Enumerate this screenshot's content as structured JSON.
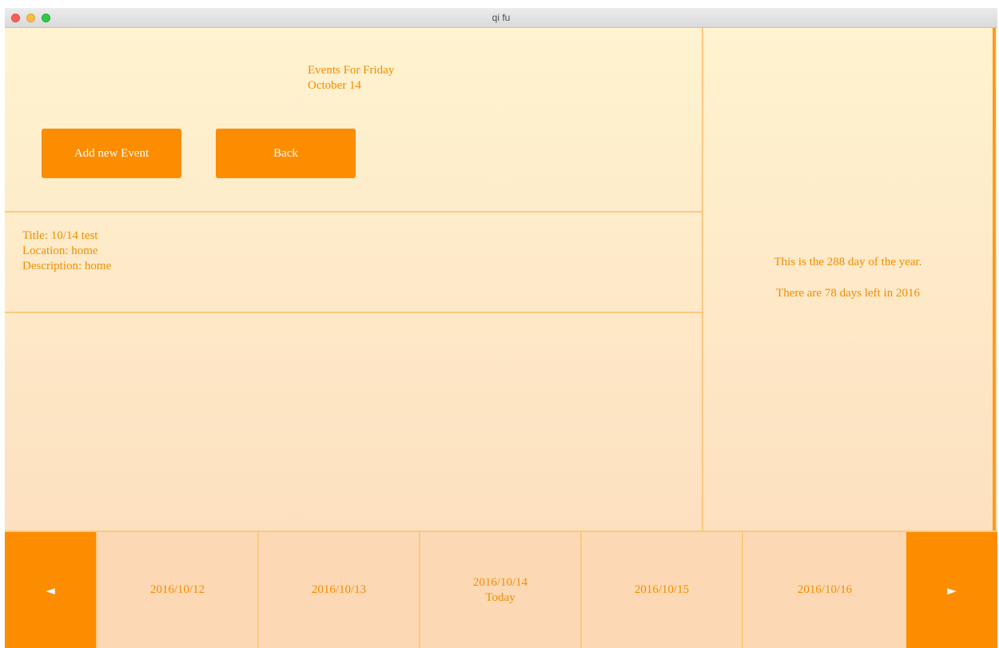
{
  "window": {
    "title": "qi fu"
  },
  "header": {
    "line1": "Events For Friday",
    "line2": "October 14"
  },
  "buttons": {
    "add_label": "Add new Event",
    "back_label": "Back"
  },
  "event": {
    "title": "Title: 10/14 test",
    "location": "Location: home",
    "description": "Description: home"
  },
  "side": {
    "day_of_year": "This is the 288 day of the year.",
    "days_left": "There are 78 days left in 2016"
  },
  "nav": {
    "prev_icon": "◄",
    "next_icon": "►",
    "days": [
      {
        "date": "2016/10/12",
        "note": ""
      },
      {
        "date": "2016/10/13",
        "note": ""
      },
      {
        "date": "2016/10/14",
        "note": "Today"
      },
      {
        "date": "2016/10/15",
        "note": ""
      },
      {
        "date": "2016/10/16",
        "note": ""
      }
    ]
  },
  "colors": {
    "accent": "#fc8c00",
    "text": "#f28c00",
    "border": "#fcc880"
  }
}
